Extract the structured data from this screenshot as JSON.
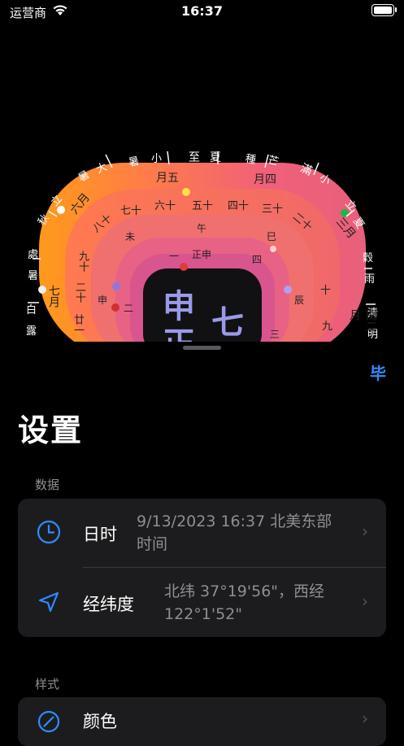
{
  "status_bar": {
    "carrier": "运营商",
    "time": "16:37"
  },
  "clock": {
    "outer_ring_top": [
      "暑",
      "大",
      "暑",
      "小",
      "至",
      "夏",
      "種",
      "芒",
      "滿",
      "小"
    ],
    "outer_ring_left": [
      "立",
      "秋",
      "處",
      "暑",
      "白",
      "露"
    ],
    "outer_ring_right": [
      "立",
      "夏",
      "穀",
      "雨",
      "清",
      "明"
    ],
    "month_ring": [
      "月五",
      "月四",
      "六月",
      "七月",
      "三月",
      "閏二月"
    ],
    "day_ring": [
      "六十",
      "五十",
      "四十",
      "三十",
      "七十",
      "二十",
      "八十",
      "十",
      "九十",
      "九",
      "二十",
      "廿一"
    ],
    "hour_ring": [
      "午",
      "未",
      "巳",
      "申",
      "辰",
      "正申",
      "一",
      "四",
      "二",
      "三"
    ],
    "center_text": [
      "申",
      "正",
      "七"
    ],
    "colors": {
      "outer": "#f0607a",
      "month": "#ff7a4a",
      "day": "#f06a6a",
      "hour": "#e05a7a",
      "inner": "#d8508a"
    }
  },
  "badge": "毕",
  "title": "设置",
  "sections": [
    {
      "label": "数据",
      "rows": [
        {
          "icon": "clock-icon",
          "label": "日时",
          "value": [
            "9/13/2023 16:37 北美东部",
            "时间"
          ]
        },
        {
          "icon": "location-arrow-icon",
          "label": "经纬度",
          "value": [
            "北纬 37°19'56\"，西经",
            "122°1'52\""
          ]
        }
      ]
    },
    {
      "label": "样式",
      "rows": [
        {
          "icon": "palette-icon",
          "label": "颜色"
        }
      ]
    }
  ],
  "accent": "#2f8cff"
}
